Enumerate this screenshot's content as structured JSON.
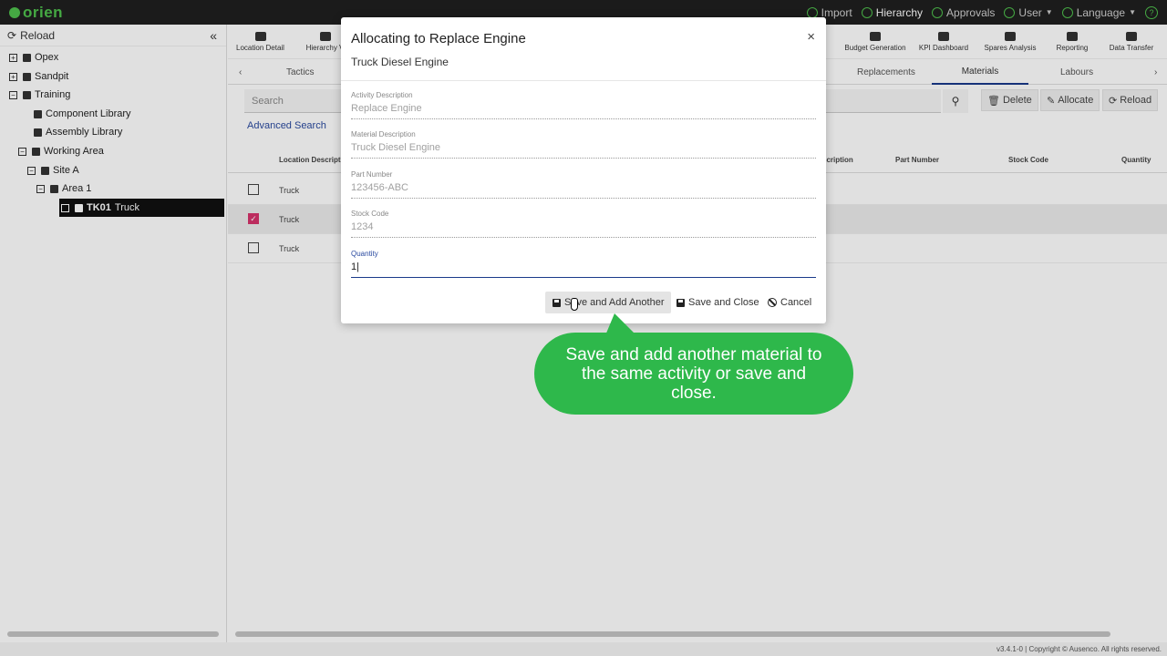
{
  "app": {
    "logo": "orien"
  },
  "topnav": {
    "import": "Import",
    "hierarchy": "Hierarchy",
    "approvals": "Approvals",
    "user": "User",
    "language": "Language",
    "help": "?"
  },
  "sidebar": {
    "reload": "Reload",
    "tree": [
      {
        "label": "Opex"
      },
      {
        "label": "Sandpit"
      },
      {
        "label": "Training"
      },
      {
        "label": "Component Library"
      },
      {
        "label": "Assembly Library"
      },
      {
        "label": "Working Area"
      },
      {
        "label": "Site A"
      },
      {
        "label": "Area 1"
      },
      {
        "code": "TK01",
        "label": "Truck"
      }
    ]
  },
  "toolbar": {
    "left": [
      "Location Detail",
      "Hierarchy V"
    ],
    "right": [
      "Budget Generation",
      "KPI Dashboard",
      "Spares Analysis",
      "Reporting",
      "Data Transfer"
    ]
  },
  "subtabs": {
    "tactics": "Tactics",
    "replacements": "Replacements",
    "materials": "Materials",
    "labours": "Labours"
  },
  "search": {
    "placeholder": "Search",
    "advanced": "Advanced Search"
  },
  "actions": {
    "delete": "Delete",
    "allocate": "Allocate",
    "reload": "Reload"
  },
  "table": {
    "headers": {
      "location": "Location Descripti",
      "description": "scription",
      "part": "Part Number",
      "stock": "Stock Code",
      "qty": "Quantity"
    },
    "rows": [
      {
        "location": "Truck",
        "checked": false
      },
      {
        "location": "Truck",
        "checked": true
      },
      {
        "location": "Truck",
        "checked": false
      }
    ]
  },
  "modal": {
    "title": "Allocating to Replace Engine",
    "subtitle": "Truck Diesel Engine",
    "close": "×",
    "fields": [
      {
        "label": "Activity Description",
        "value": "Replace Engine"
      },
      {
        "label": "Material Description",
        "value": "Truck Diesel Engine"
      },
      {
        "label": "Part Number",
        "value": "123456-ABC"
      },
      {
        "label": "Stock Code",
        "value": "1234"
      },
      {
        "label": "Quantity",
        "value": "1|"
      }
    ],
    "buttons": {
      "save_add": "Save and Add Another",
      "save_close": "Save and Close",
      "cancel": "Cancel"
    }
  },
  "callout": {
    "text": "Save and add another material to the same activity or save and close."
  },
  "footer": {
    "text": "v3.4.1-0 | Copyright © Ausenco. All rights reserved."
  },
  "colors": {
    "brand": "#4fc14d",
    "accent": "#1a3a8a",
    "callout": "#2eb84b",
    "check": "#d6336c"
  }
}
